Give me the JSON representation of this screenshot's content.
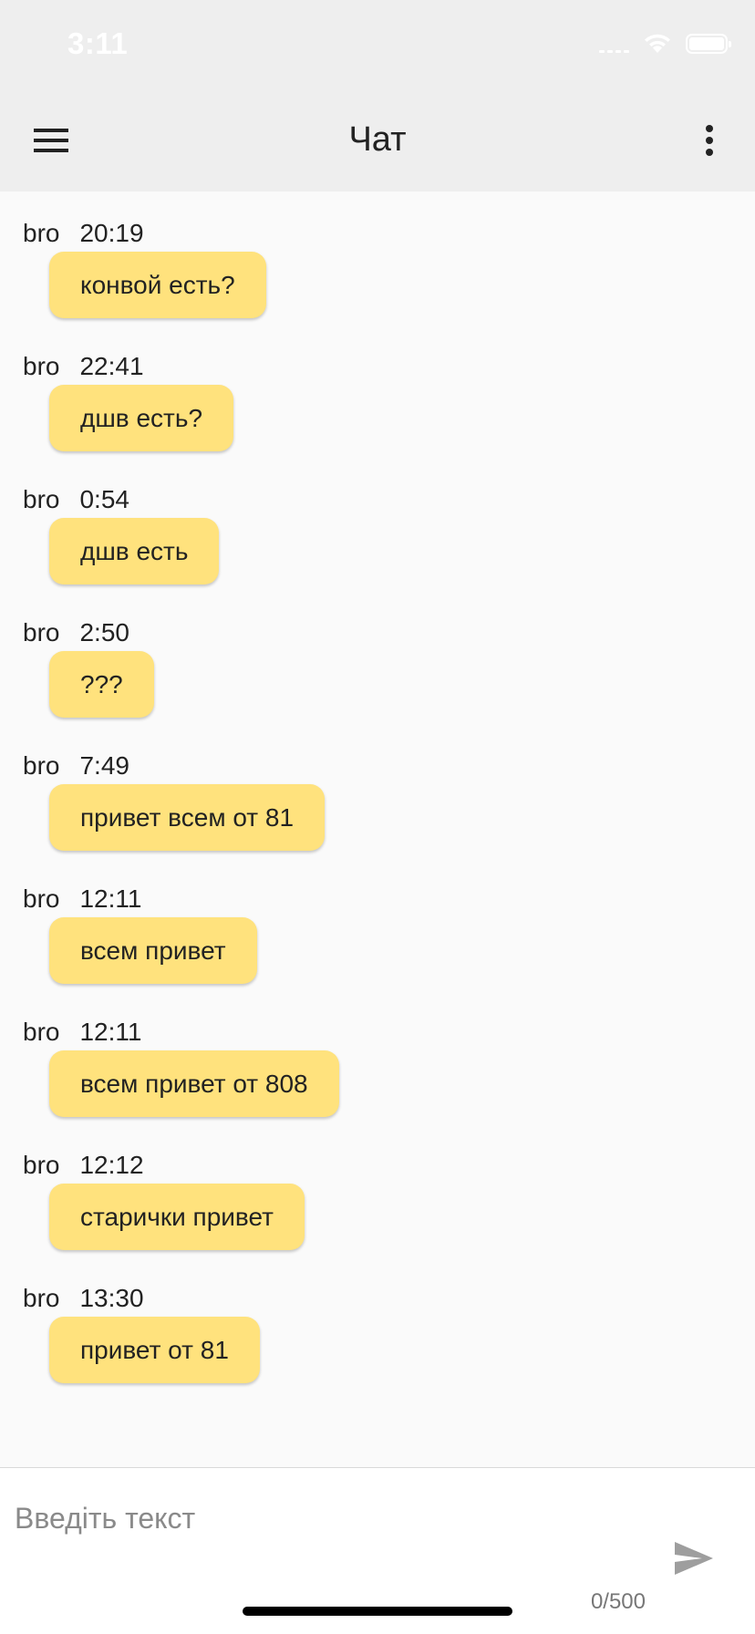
{
  "status_bar": {
    "time": "3:11",
    "icons": [
      "cellular-signal-icon",
      "wifi-icon",
      "battery-icon"
    ],
    "text_color": "#ffffff"
  },
  "app_bar": {
    "title": "Чат",
    "menu_icon": "hamburger-menu-icon",
    "more_icon": "more-vertical-icon",
    "background": "#eeeeee"
  },
  "messages": [
    {
      "author": "bro",
      "time": "20:19",
      "text": "конвой есть?"
    },
    {
      "author": "bro",
      "time": "22:41",
      "text": "дшв есть?"
    },
    {
      "author": "bro",
      "time": "0:54",
      "text": "дшв есть"
    },
    {
      "author": "bro",
      "time": "2:50",
      "text": "???"
    },
    {
      "author": "bro",
      "time": "7:49",
      "text": "привет всем от 81"
    },
    {
      "author": "bro",
      "time": "12:11",
      "text": "всем привет"
    },
    {
      "author": "bro",
      "time": "12:11",
      "text": "всем привет от 808"
    },
    {
      "author": "bro",
      "time": "12:12",
      "text": "старички привет"
    },
    {
      "author": "bro",
      "time": "13:30",
      "text": "привет от 81"
    }
  ],
  "composer": {
    "placeholder": "Введіть текст",
    "value": "",
    "counter": "0/500",
    "send_icon": "send-icon"
  },
  "colors": {
    "bubble": "#ffe27d",
    "background": "#fafafa",
    "send_icon": "#9e9e9e"
  }
}
